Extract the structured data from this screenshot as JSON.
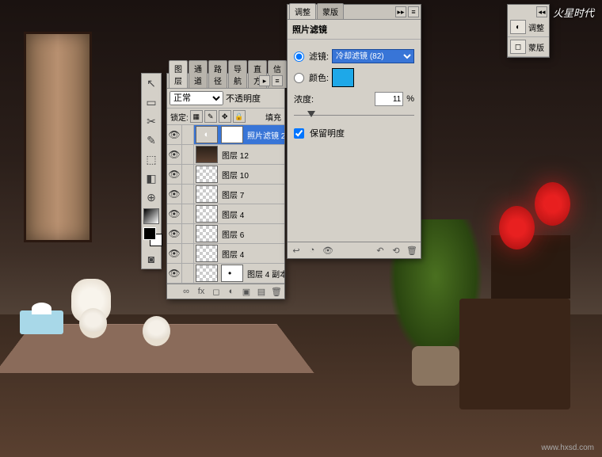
{
  "watermark": {
    "top": "火星时代",
    "bottom": "www.hxsd.com"
  },
  "layersPanel": {
    "tabs": [
      "图层",
      "通道",
      "路径",
      "导航",
      "直方",
      "信息"
    ],
    "activeTab": 0,
    "blendMode": "正常",
    "opacityLabel": "不透明度",
    "lockLabel": "锁定:",
    "fillLabel": "填充",
    "layers": [
      {
        "name": "照片滤镜 2",
        "sel": true,
        "type": "adj"
      },
      {
        "name": "图层 12",
        "type": "img"
      },
      {
        "name": "图层 10",
        "type": "trans"
      },
      {
        "name": "图层 7",
        "type": "trans"
      },
      {
        "name": "图层 4",
        "type": "trans"
      },
      {
        "name": "图层 6",
        "type": "trans"
      },
      {
        "name": "图层 4",
        "type": "trans"
      },
      {
        "name": "图层 4 副本",
        "type": "trans",
        "mask": true
      }
    ]
  },
  "adjustPanel": {
    "tabs": [
      "调整",
      "蒙版"
    ],
    "title": "照片滤镜",
    "filterLabel": "滤镜:",
    "filterValue": "冷却滤镜 (82)",
    "colorLabel": "颜色:",
    "colorValue": "#1ea8e8",
    "densityLabel": "浓度:",
    "densityValue": "11",
    "densityUnit": "%",
    "preserveLabel": "保留明度",
    "preserveChecked": true,
    "filterSelected": true
  },
  "rightStrip": {
    "items": [
      {
        "icon": "◐",
        "label": "调整"
      },
      {
        "icon": "◻",
        "label": "蒙版"
      }
    ]
  },
  "toolbox": {
    "tools": [
      "↖",
      "▭",
      "✂",
      "✎",
      "⬚",
      "◧",
      "⊕"
    ]
  }
}
